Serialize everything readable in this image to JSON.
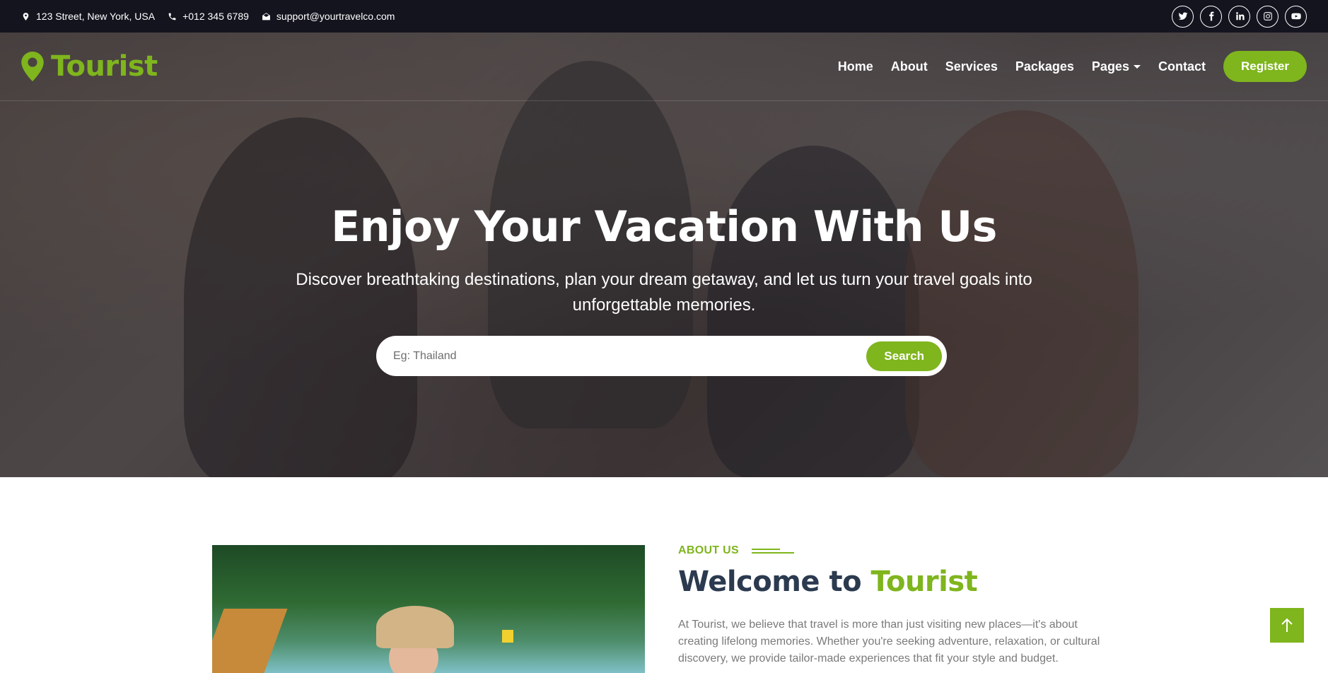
{
  "topbar": {
    "address": "123 Street, New York, USA",
    "phone": "+012 345 6789",
    "email": "support@yourtravelco.com",
    "socials": [
      "twitter-icon",
      "facebook-icon",
      "linkedin-icon",
      "instagram-icon",
      "youtube-icon"
    ]
  },
  "brand": {
    "name": "Tourist",
    "color": "#7fb51d"
  },
  "nav": {
    "home": "Home",
    "about": "About",
    "services": "Services",
    "packages": "Packages",
    "pages": "Pages",
    "contact": "Contact",
    "register": "Register"
  },
  "hero": {
    "title": "Enjoy Your Vacation With Us",
    "subtitle": "Discover breathtaking destinations, plan your dream getaway, and let us turn your travel goals into unforgettable memories.",
    "search_placeholder": "Eg: Thailand",
    "search_button": "Search"
  },
  "about": {
    "tag": "ABOUT US",
    "heading_prefix": "Welcome to",
    "heading_accent": "Tourist",
    "paragraph": "At Tourist, we believe that travel is more than just visiting new places—it's about creating lifelong memories. Whether you're seeking adventure, relaxation, or cultural discovery, we provide tailor-made experiences that fit your style and budget."
  },
  "colors": {
    "accent": "#7fb51d",
    "topbar": "#14141f",
    "heading": "#2b3a4f"
  }
}
